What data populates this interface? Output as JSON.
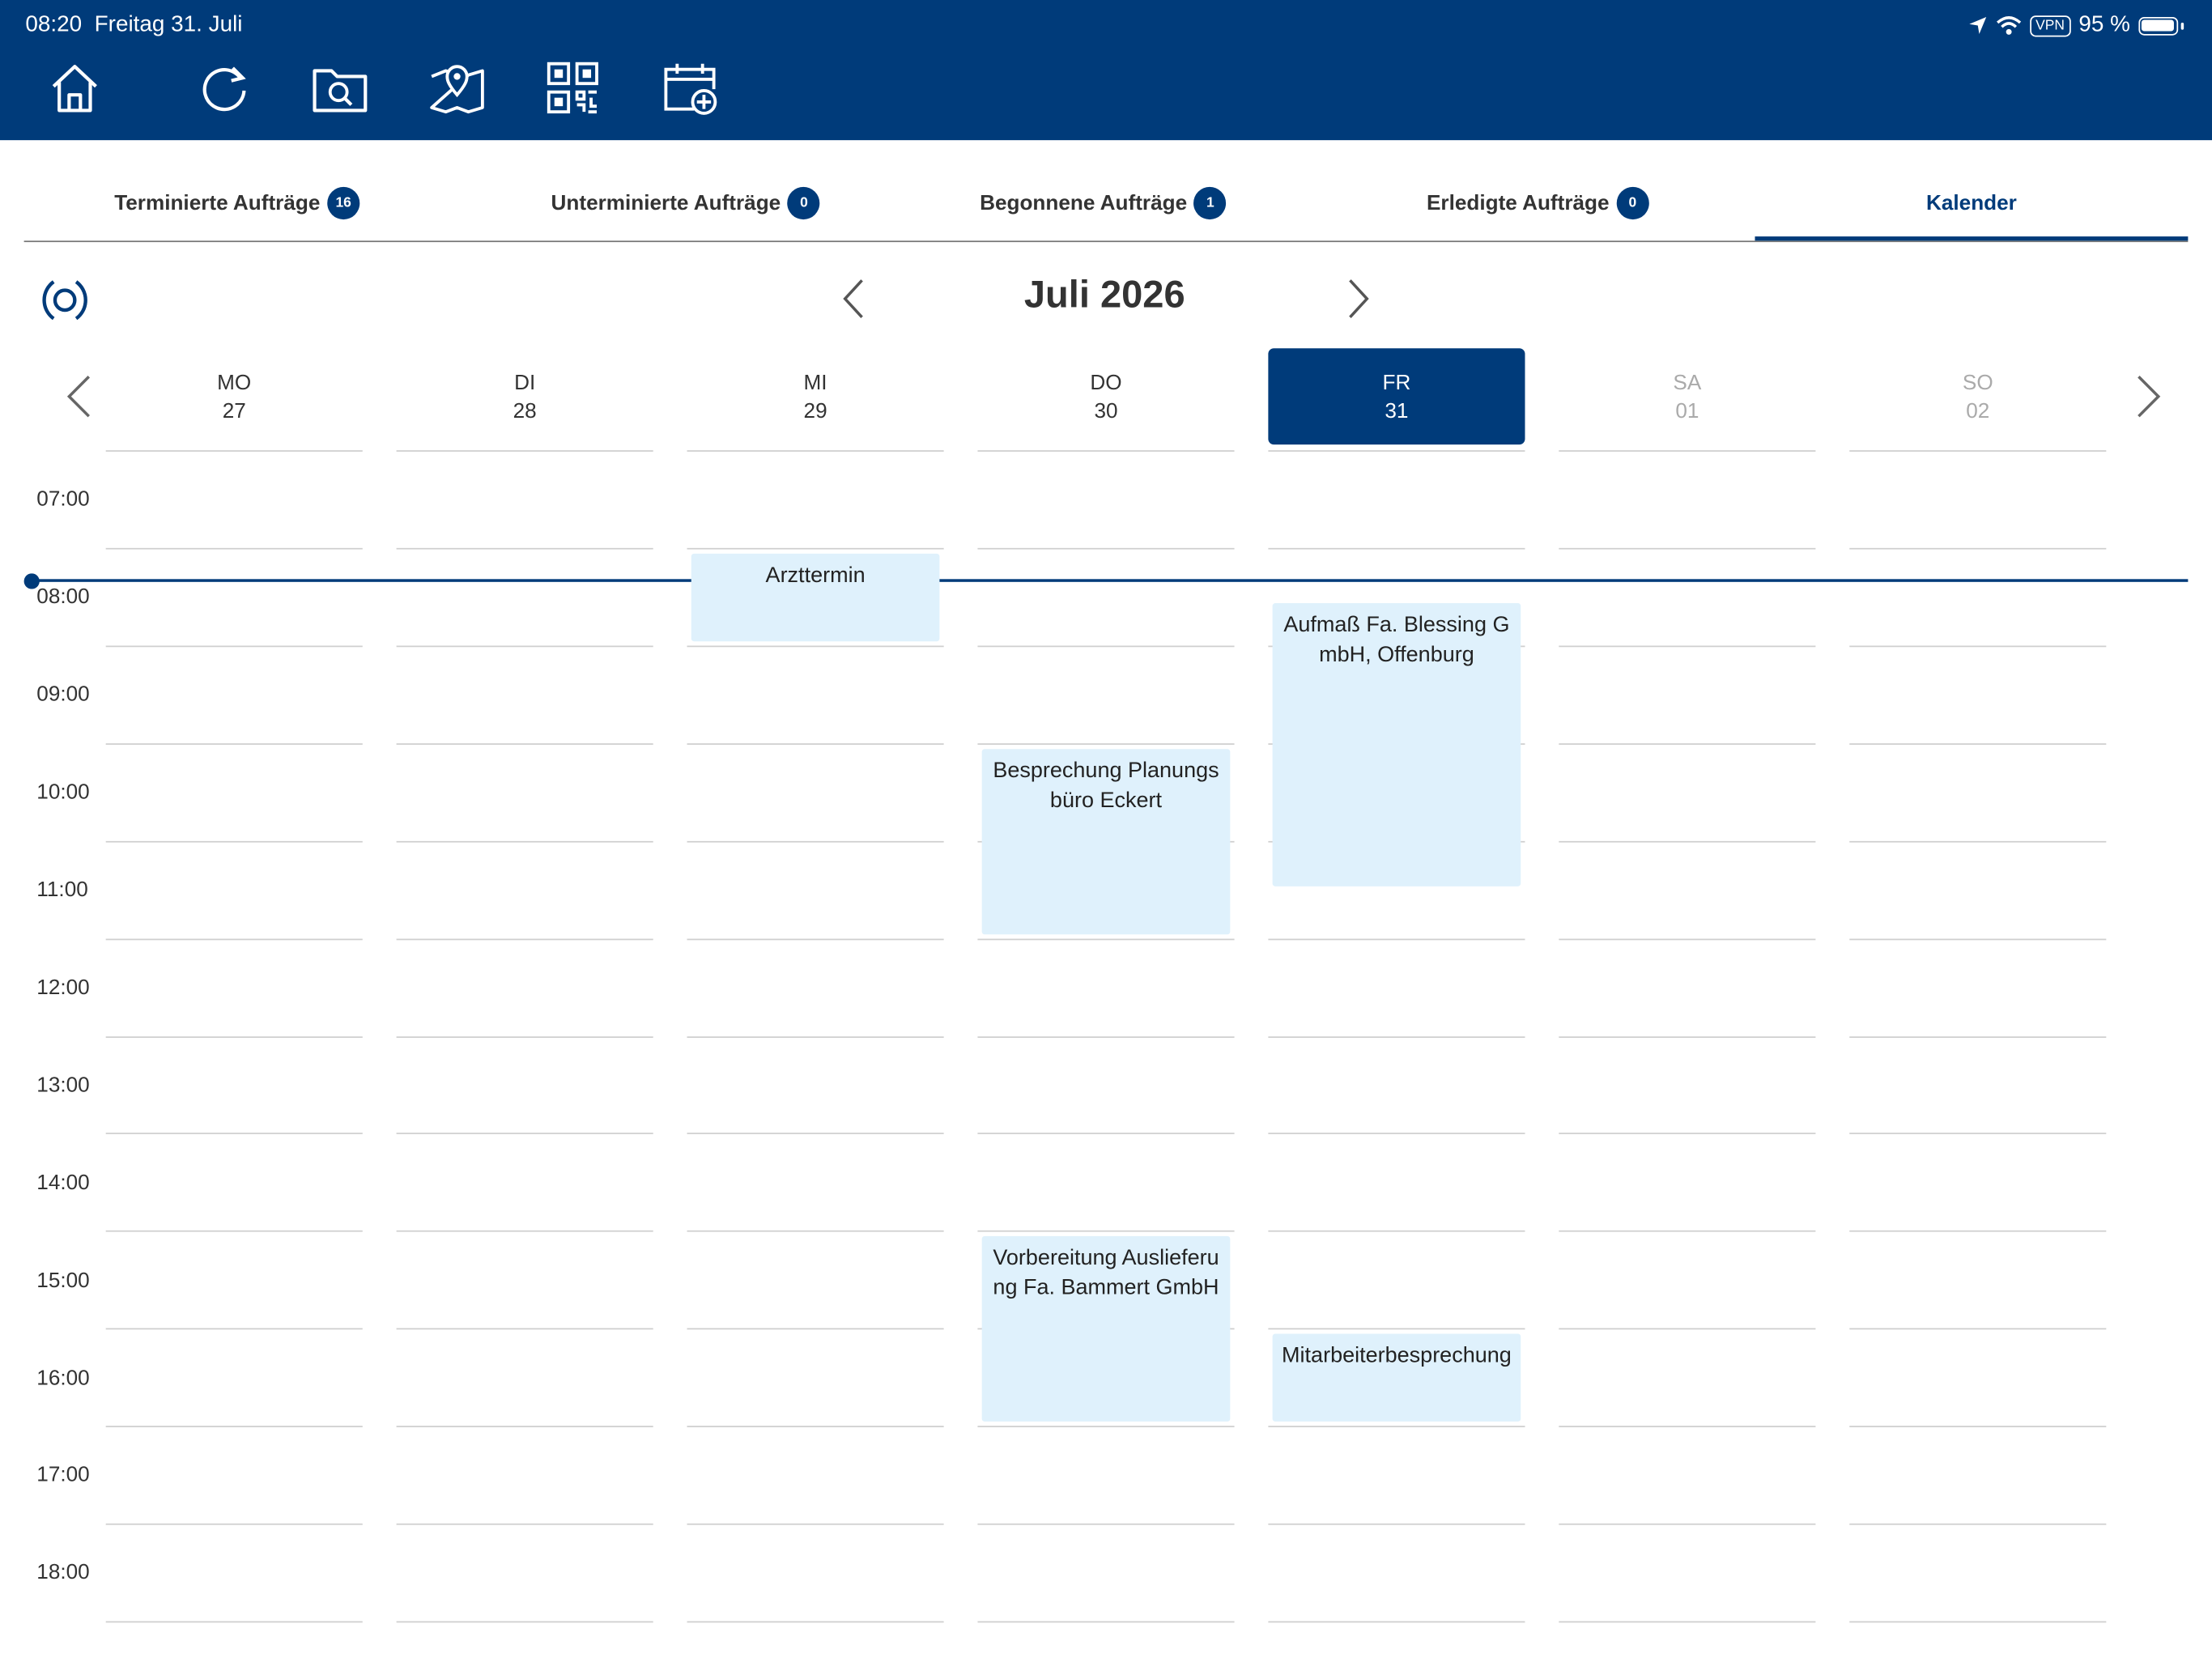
{
  "status_bar": {
    "time": "08:20",
    "date": "Freitag 31. Juli",
    "vpn": "VPN",
    "battery": "95 %"
  },
  "toolbar": [
    {
      "name": "home-button",
      "icon": "home-icon"
    },
    {
      "name": "refresh-button",
      "icon": "refresh-icon"
    },
    {
      "name": "search-folder-button",
      "icon": "folder-search-icon"
    },
    {
      "name": "map-button",
      "icon": "map-pin-icon"
    },
    {
      "name": "qr-scan-button",
      "icon": "qr-code-icon"
    },
    {
      "name": "add-appointment-button",
      "icon": "calendar-add-icon"
    }
  ],
  "tabs": [
    {
      "label": "Terminierte Aufträge",
      "badge": "16"
    },
    {
      "label": "Unterminierte Aufträge",
      "badge": "0"
    },
    {
      "label": "Begonnene Aufträge",
      "badge": "1"
    },
    {
      "label": "Erledigte Aufträge",
      "badge": "0"
    },
    {
      "label": "Kalender",
      "badge": null
    }
  ],
  "calendar": {
    "month_title": "Juli 2026",
    "days": [
      {
        "name": "MO",
        "date": "27"
      },
      {
        "name": "DI",
        "date": "28"
      },
      {
        "name": "MI",
        "date": "29"
      },
      {
        "name": "DO",
        "date": "30"
      },
      {
        "name": "FR",
        "date": "31",
        "selected": true
      },
      {
        "name": "SA",
        "date": "01",
        "weekend": true
      },
      {
        "name": "SO",
        "date": "02",
        "weekend": true
      }
    ],
    "hours": [
      "07:00",
      "08:00",
      "09:00",
      "10:00",
      "11:00",
      "12:00",
      "13:00",
      "14:00",
      "15:00",
      "16:00",
      "17:00",
      "18:00"
    ],
    "current_time": "08:20",
    "events": [
      {
        "title": "Arzttermin",
        "day": "MI",
        "start": "08:10",
        "end": "09:00"
      },
      {
        "title": "Besprechung Planungsbüro Eckert",
        "day": "DO",
        "start": "10:00",
        "end": "11:55"
      },
      {
        "title": "Aufmaß Fa. Blessing GmbH, Offenburg",
        "day": "FR",
        "start": "08:35",
        "end": "11:30"
      },
      {
        "title": "Vorbereitung Auslieferung Fa. Bammert GmbH",
        "day": "DO",
        "start": "15:00",
        "end": "16:55"
      },
      {
        "title": "Mitarbeiterbesprechung",
        "day": "FR",
        "start": "16:00",
        "end": "16:55"
      }
    ]
  },
  "colors": {
    "brand": "#003b7a",
    "event_bg": "#dff1fc",
    "gridline": "#cfcfcf"
  }
}
